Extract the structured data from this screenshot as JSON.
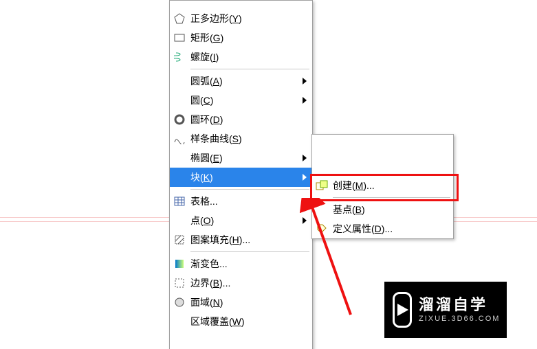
{
  "main_menu": {
    "items": [
      {
        "icon": "polygon",
        "label": "正多边形",
        "key": "Y"
      },
      {
        "icon": "rect",
        "label": "矩形",
        "key": "G"
      },
      {
        "icon": "helix",
        "label": "螺旋",
        "key": "I"
      },
      {
        "sep": true
      },
      {
        "icon": "",
        "label": "圆弧",
        "key": "A",
        "submenu": true
      },
      {
        "icon": "",
        "label": "圆",
        "key": "C",
        "submenu": true
      },
      {
        "icon": "donut",
        "label": "圆环",
        "key": "D"
      },
      {
        "icon": "spline",
        "label": "样条曲线",
        "key": "S"
      },
      {
        "icon": "",
        "label": "椭圆",
        "key": "E",
        "submenu": true
      },
      {
        "icon": "",
        "label": "块",
        "key": "K",
        "submenu": true,
        "selected": true
      },
      {
        "sep": true
      },
      {
        "icon": "table",
        "label": "表格..."
      },
      {
        "icon": "",
        "label": "点",
        "key": "O",
        "submenu": true
      },
      {
        "icon": "hatch",
        "label": "图案填充",
        "key": "H",
        "ellipsis": true
      },
      {
        "sep": true
      },
      {
        "icon": "gradient",
        "label": "渐变色..."
      },
      {
        "icon": "boundary",
        "label": "边界",
        "key": "B",
        "ellipsis": true
      },
      {
        "icon": "region",
        "label": "面域",
        "key": "N"
      },
      {
        "icon": "",
        "label": "区域覆盖",
        "key": "W"
      }
    ]
  },
  "sub_menu": {
    "title_spacer_height": 60,
    "items": [
      {
        "icon": "blockcreate",
        "label": "创建",
        "key": "M",
        "ellipsis": true
      },
      {
        "sep": true
      },
      {
        "icon": "",
        "label": "基点",
        "key": "B"
      },
      {
        "icon": "attdef",
        "label": "定义属性",
        "key": "D",
        "ellipsis": true
      }
    ]
  },
  "logo": {
    "title": "溜溜自学",
    "sub": "ZIXUE.3D66.COM"
  },
  "colors": {
    "highlight": "#2a84ea",
    "red": "#e11"
  }
}
